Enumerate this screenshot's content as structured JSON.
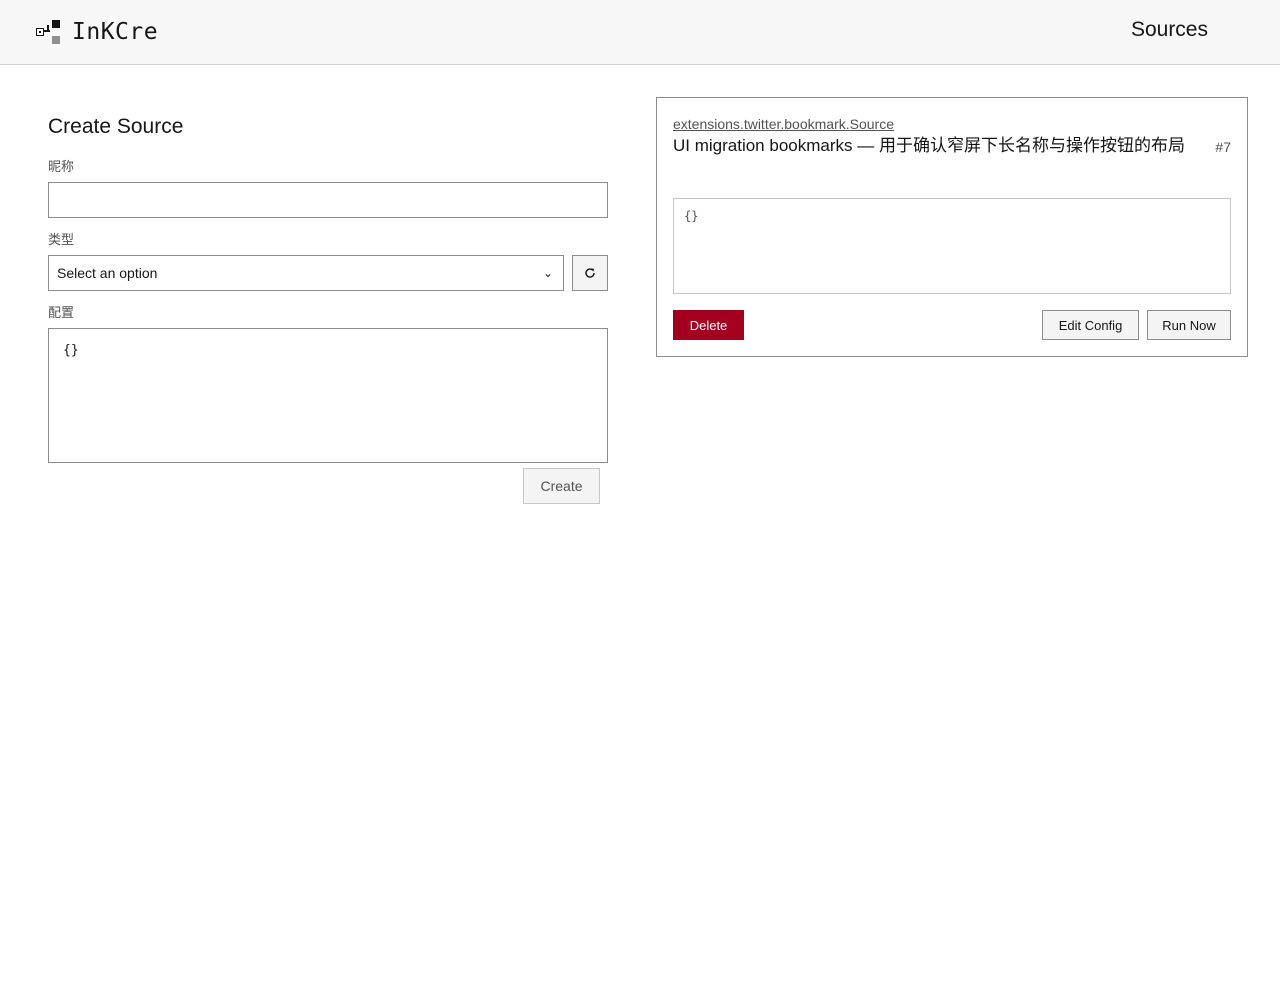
{
  "header": {
    "brand_name": "InKCre",
    "nav_sources": "Sources"
  },
  "create_form": {
    "title": "Create Source",
    "nickname_label": "昵称",
    "nickname_value": "",
    "type_label": "类型",
    "type_selected": "Select an option",
    "config_label": "配置",
    "config_value": "{}",
    "create_label": "Create"
  },
  "source_card": {
    "type_link": "extensions.twitter.bookmark.Source",
    "title": "UI migration bookmarks — 用于确认窄屏下长名称与操作按钮的布局",
    "id": "#7",
    "config": "{}",
    "delete_label": "Delete",
    "edit_config_label": "Edit Config",
    "run_now_label": "Run Now"
  },
  "colors": {
    "header_bg": "#f7f7f7",
    "danger": "#a2001e",
    "border": "#8d8d8d"
  },
  "icons": {
    "logo": "inkcre-logo-icon",
    "select_chevron": "chevron-down-icon",
    "refresh": "refresh-icon"
  }
}
